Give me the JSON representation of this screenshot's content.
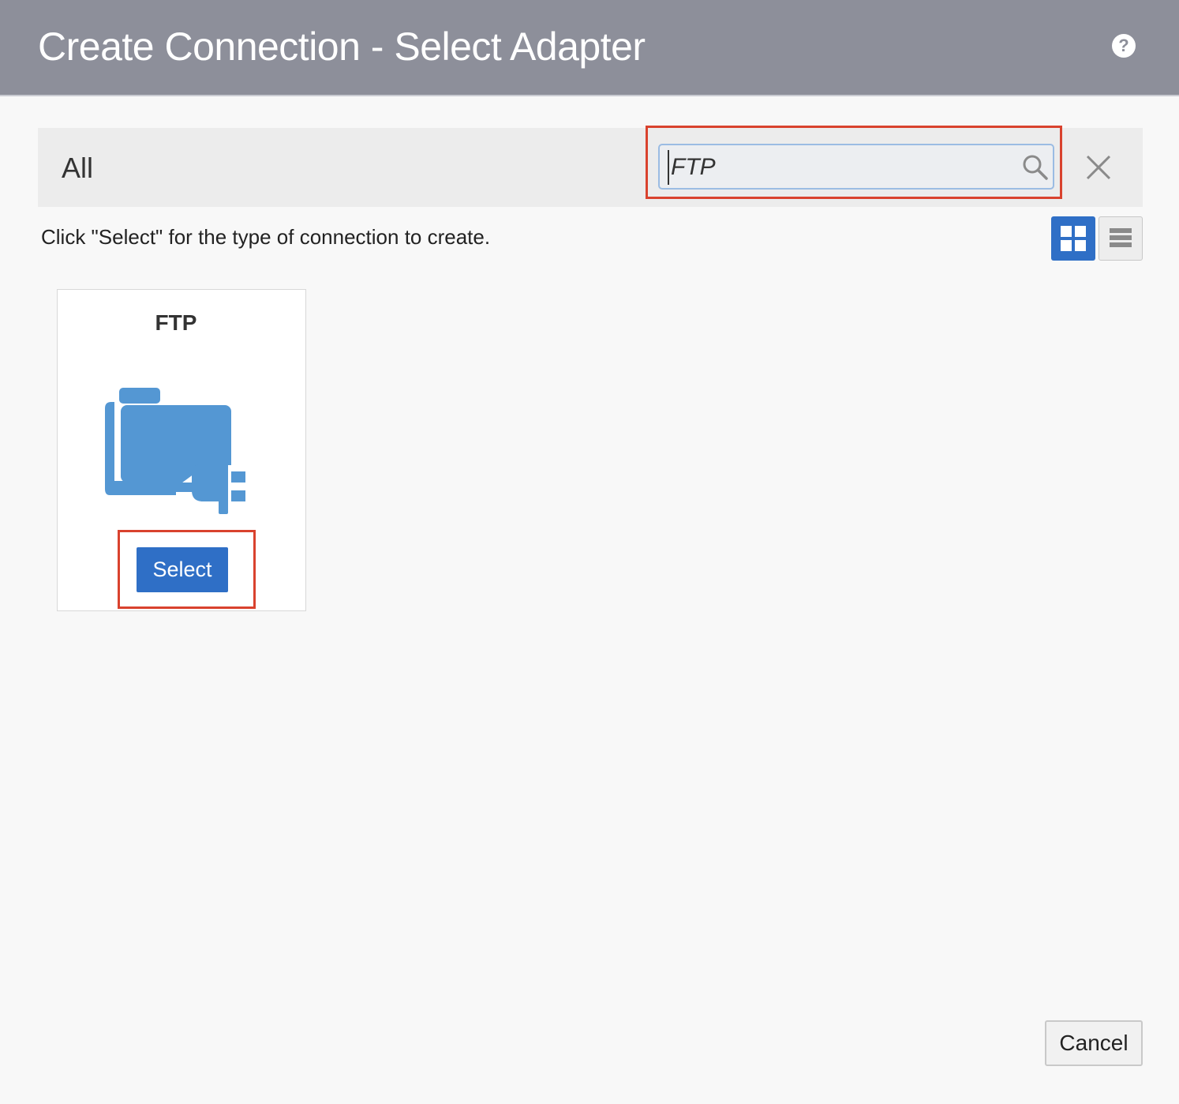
{
  "dialog": {
    "title": "Create Connection - Select Adapter",
    "help_icon": "question-circle-icon"
  },
  "filter": {
    "category_label": "All",
    "search_value": "FTP",
    "search_icon": "search-icon",
    "clear_icon": "close-icon"
  },
  "instruction": "Click \"Select\" for the type of connection to create.",
  "view_toggle": {
    "grid_icon": "grid-view-icon",
    "list_icon": "list-view-icon",
    "active": "grid"
  },
  "adapters": [
    {
      "name": "FTP",
      "icon": "folder-plug-icon",
      "select_label": "Select"
    }
  ],
  "footer": {
    "cancel_label": "Cancel"
  },
  "colors": {
    "header_bg": "#8d8f9a",
    "primary": "#2f6fc6",
    "highlight": "#d9422e",
    "icon_blue": "#5497d3"
  }
}
